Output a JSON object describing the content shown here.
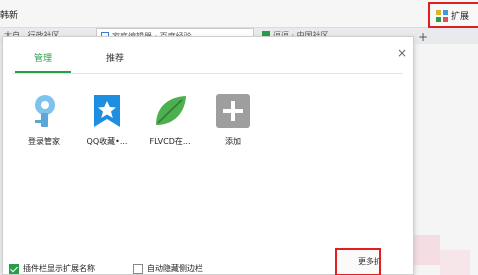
{
  "toolbar": {
    "left_text": "韩新",
    "extension_button_label": "扩展"
  },
  "browser_tabs": [
    {
      "label": "大自...行政社区"
    },
    {
      "label": "家庭编辑器 · 百度经验"
    },
    {
      "label": "逗逗 · 中国社区"
    }
  ],
  "newtab_symbol": "+",
  "popup": {
    "close_symbol": "×",
    "tabs": [
      {
        "label": "管理",
        "active": true
      },
      {
        "label": "推荐",
        "active": false
      }
    ],
    "extensions": [
      {
        "name": "登录管家",
        "icon": "key-icon"
      },
      {
        "name": "QQ收藏•...",
        "icon": "star-bookmark-icon"
      },
      {
        "name": "FLVCD在...",
        "icon": "leaf-icon"
      },
      {
        "name": "添加",
        "icon": "add-icon"
      }
    ],
    "footer": {
      "show_in_toolbar_label": "插件栏显示扩展名称",
      "show_in_toolbar_checked": true,
      "auto_hide_sidebar_label": "自动隐藏侧边栏",
      "auto_hide_sidebar_checked": false,
      "more_button_label": "更多扩展"
    }
  },
  "colors": {
    "accent_green": "#2a9d48",
    "highlight_red": "#e02020",
    "qq_blue": "#1e8fe0",
    "add_gray": "#9e9e9e"
  }
}
